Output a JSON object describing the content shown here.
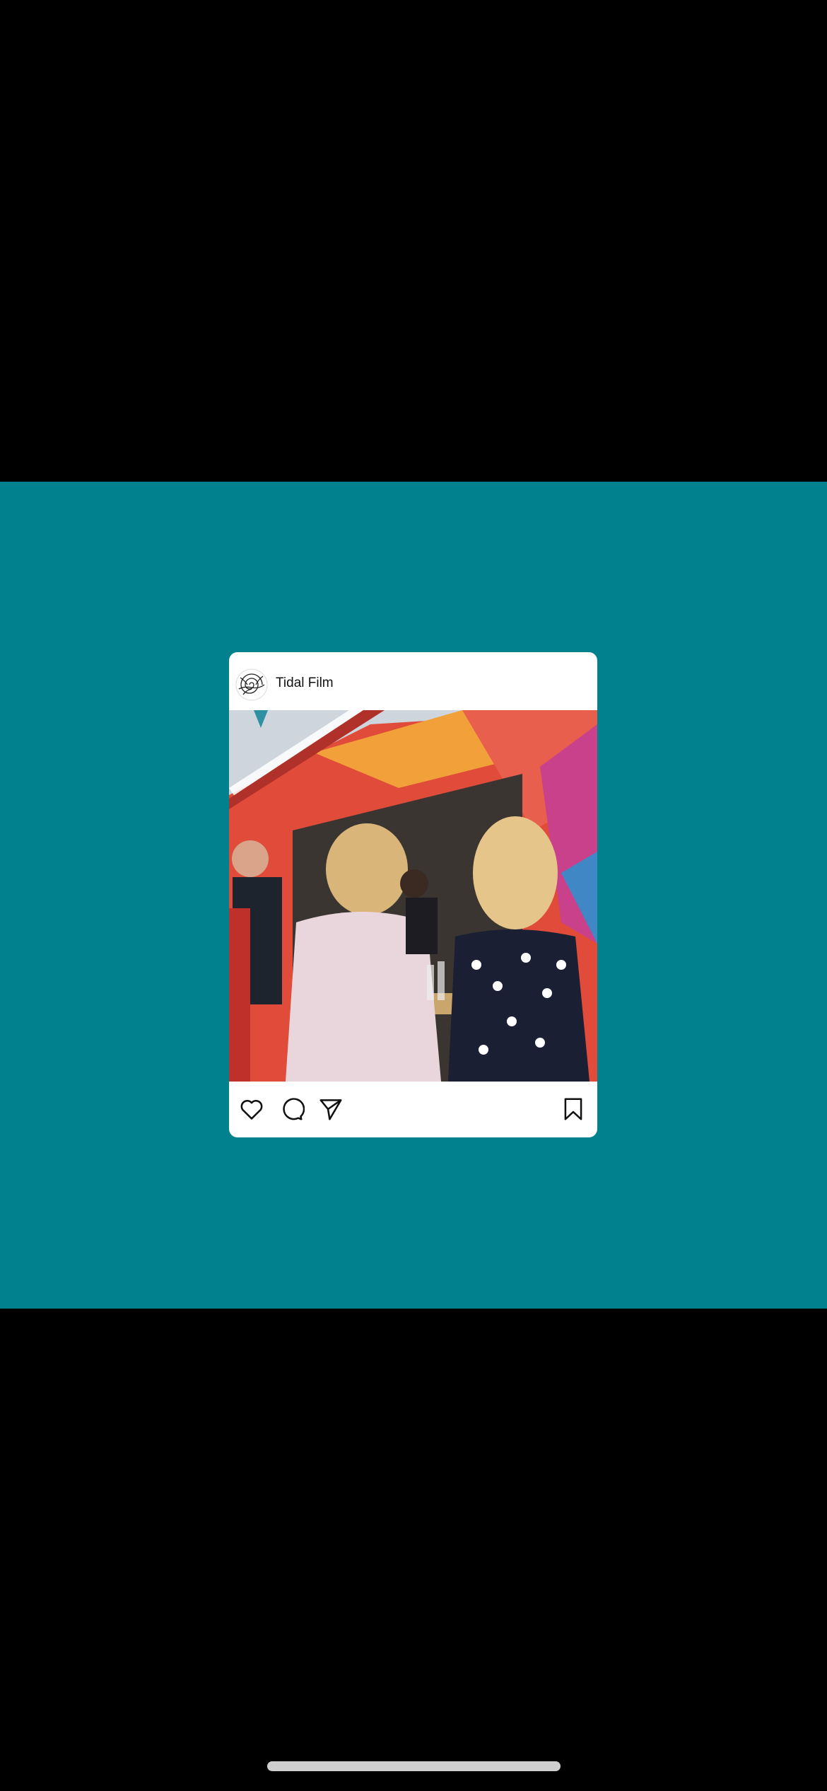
{
  "post": {
    "username": "Tidal Film",
    "avatar_icon": "spiral-logo-icon",
    "image_description_icons": [
      "photo"
    ],
    "actions": {
      "like_icon": "heart-icon",
      "comment_icon": "comment-bubble-icon",
      "share_icon": "paper-plane-icon",
      "save_icon": "bookmark-icon"
    }
  },
  "colors": {
    "background_band": "#01818E",
    "card": "#ffffff",
    "outer": "#000000"
  }
}
